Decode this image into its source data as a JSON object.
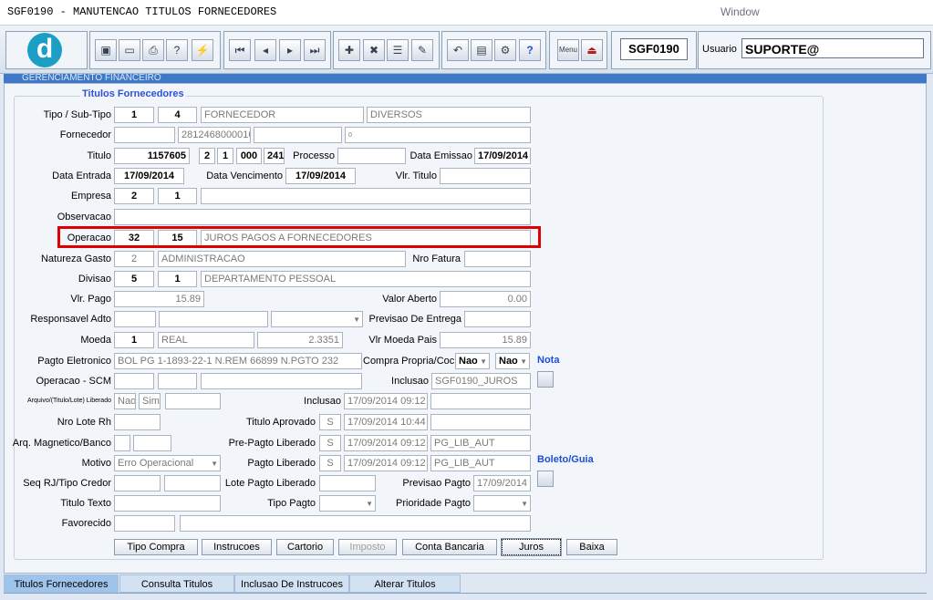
{
  "window": {
    "title": "SGF0190 - MANUTENCAO TITULOS FORNECEDORES",
    "caption": "Window"
  },
  "toolbar": {
    "module": "SGF0190",
    "user_label": "Usuario",
    "user": "SUPORTE@",
    "buttons": [
      "save-icon",
      "window-icon",
      "print-icon",
      "query-icon",
      "execute-icon",
      "first-record-icon",
      "prev-record-icon",
      "next-record-icon",
      "last-record-icon",
      "insert-icon",
      "delete-icon",
      "list-icon",
      "edit-icon",
      "undo-icon",
      "clipboard-icon",
      "tools-icon",
      "help-icon",
      "menu-icon",
      "exit-icon"
    ]
  },
  "frame_header": "GERENCIAMENTO FINANCEIRO",
  "form": {
    "title": "Titulos Fornecedores",
    "tipo_label": "Tipo / Sub-Tipo",
    "tipo": "1",
    "subtipo": "4",
    "tipo_desc": "FORNECEDOR",
    "subtipo_desc": "DIVERSOS",
    "fornecedor_label": "Fornecedor",
    "fornecedor_code": "",
    "fornecedor_cnpj": "2812468000010",
    "fornecedor_name": "",
    "fornecedor_extra": "0",
    "titulo_label": "Titulo",
    "titulo": "1157605",
    "titulo_p1": "2",
    "titulo_p2": "1",
    "titulo_p3": "000",
    "titulo_p4": "241",
    "processo_label": "Processo",
    "processo": "",
    "data_emissao_label": "Data Emissao",
    "data_emissao": "17/09/2014",
    "data_entrada_label": "Data Entrada",
    "data_entrada": "17/09/2014",
    "data_vencimento_label": "Data Vencimento",
    "data_vencimento": "17/09/2014",
    "vlr_titulo_label": "Vlr. Titulo",
    "vlr_titulo": "",
    "empresa_label": "Empresa",
    "empresa": "2",
    "empresa_p2": "1",
    "empresa_desc": "",
    "observacao_label": "Observacao",
    "observacao": "",
    "operacao_label": "Operacao",
    "operacao": "32",
    "operacao_p2": "15",
    "operacao_desc": "JUROS PAGOS A FORNECEDORES",
    "natureza_label": "Natureza Gasto",
    "natureza": "2",
    "natureza_desc": "ADMINISTRACAO",
    "nro_fatura_label": "Nro Fatura",
    "nro_fatura": "",
    "divisao_label": "Divisao",
    "divisao": "5",
    "divisao_p2": "1",
    "divisao_desc": "DEPARTAMENTO PESSOAL",
    "vlr_pago_label": "Vlr. Pago",
    "vlr_pago": "15.89",
    "valor_aberto_label": "Valor Aberto",
    "valor_aberto": "0.00",
    "responsavel_label": "Responsavel Adto",
    "previsao_entrega_label": "Previsao De Entrega",
    "moeda_label": "Moeda",
    "moeda": "1",
    "moeda_desc": "REAL",
    "moeda_taxa": "2.3351",
    "vlr_moeda_pais_label": "Vlr Moeda Pais",
    "vlr_moeda_pais": "15.89",
    "pagto_eletronico_label": "Pagto Eletronico",
    "pagto_eletronico": "BOL  PG 1-1893-22-1 N.REM 66899 N.PGTO 232",
    "compra_propria_label": "Compra Propria/Coc",
    "compra_propria": "Nao",
    "coc": "Nao",
    "nota_label": "Nota",
    "operacao_scm_label": "Operacao - SCM",
    "inclusao_label": "Inclusao",
    "inclusao": "SGF0190_JUROS",
    "arquivo_label": "Arquivo/(Titulo/Lote) Liberado",
    "arquivo_nao": "Nao",
    "arquivo_sim": "Sim",
    "inclusao2_label": "Inclusao",
    "inclusao2_data": "17/09/2014 09:12",
    "nro_lote_label": "Nro Lote Rh",
    "titulo_aprovado_label": "Titulo Aprovado",
    "titulo_aprovado": "S",
    "titulo_aprovado_data": "17/09/2014 10:44",
    "arq_magnetico_label": "Arq. Magnetico/Banco",
    "pre_pagto_label": "Pre-Pagto Liberado",
    "pre_pagto": "S",
    "pre_pagto_data": "17/09/2014 09:12",
    "pre_pagto_user": "PG_LIB_AUT",
    "motivo_label": "Motivo",
    "motivo": "Erro Operacional",
    "pagto_liberado_label": "Pagto Liberado",
    "pagto_liberado": "S",
    "pagto_liberado_data": "17/09/2014 09:12",
    "pagto_liberado_user": "PG_LIB_AUT",
    "boleto_label": "Boleto/Guia",
    "seq_rj_label": "Seq RJ/Tipo Credor",
    "lote_pagto_label": "Lote Pagto Liberado",
    "previsao_pagto_label": "Previsao Pagto",
    "previsao_pagto": "17/09/2014",
    "titulo_texto_label": "Titulo Texto",
    "tipo_pagto_label": "Tipo Pagto",
    "prioridade_label": "Prioridade Pagto",
    "favorecido_label": "Favorecido"
  },
  "buttons": {
    "tipo_compra": "Tipo Compra",
    "instrucoes": "Instrucoes",
    "cartorio": "Cartorio",
    "imposto": "Imposto",
    "conta_bancaria": "Conta Bancaria",
    "juros": "Juros",
    "baixa": "Baixa"
  },
  "tabs": [
    "Titulos Fornecedores",
    "Consulta Titulos",
    "Inclusao De Instrucoes",
    "Alterar Titulos"
  ]
}
